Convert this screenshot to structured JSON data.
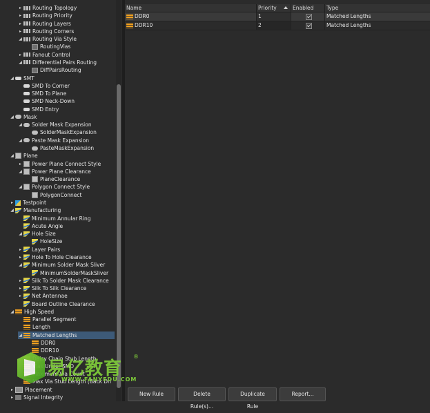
{
  "tree": [
    {
      "label": "Routing Topology",
      "indent": 1,
      "arrow": "▸",
      "icon": "route"
    },
    {
      "label": "Routing Priority",
      "indent": 1,
      "arrow": "▸",
      "icon": "route"
    },
    {
      "label": "Routing Layers",
      "indent": 1,
      "arrow": "▸",
      "icon": "route"
    },
    {
      "label": "Routing Corners",
      "indent": 1,
      "arrow": "▸",
      "icon": "route"
    },
    {
      "label": "Routing Via Style",
      "indent": 1,
      "arrow": "◢",
      "icon": "route"
    },
    {
      "label": "RoutingVias",
      "indent": 2,
      "arrow": "",
      "icon": "routesub"
    },
    {
      "label": "Fanout Control",
      "indent": 1,
      "arrow": "▸",
      "icon": "route"
    },
    {
      "label": "Differential Pairs Routing",
      "indent": 1,
      "arrow": "◢",
      "icon": "route"
    },
    {
      "label": "DiffPairsRouting",
      "indent": 2,
      "arrow": "",
      "icon": "routesub"
    },
    {
      "label": "SMT",
      "indent": 0,
      "arrow": "◢",
      "icon": "smd"
    },
    {
      "label": "SMD To Corner",
      "indent": 1,
      "arrow": "",
      "icon": "smd"
    },
    {
      "label": "SMD To Plane",
      "indent": 1,
      "arrow": "",
      "icon": "smd"
    },
    {
      "label": "SMD Neck-Down",
      "indent": 1,
      "arrow": "",
      "icon": "smd"
    },
    {
      "label": "SMD Entry",
      "indent": 1,
      "arrow": "",
      "icon": "smd"
    },
    {
      "label": "Mask",
      "indent": 0,
      "arrow": "◢",
      "icon": "mask"
    },
    {
      "label": "Solder Mask Expansion",
      "indent": 1,
      "arrow": "◢",
      "icon": "mask"
    },
    {
      "label": "SolderMaskExpansion",
      "indent": 2,
      "arrow": "",
      "icon": "mask"
    },
    {
      "label": "Paste Mask Expansion",
      "indent": 1,
      "arrow": "◢",
      "icon": "mask"
    },
    {
      "label": "PasteMaskExpansion",
      "indent": 2,
      "arrow": "",
      "icon": "mask"
    },
    {
      "label": "Plane",
      "indent": 0,
      "arrow": "◢",
      "icon": "plane"
    },
    {
      "label": "Power Plane Connect Style",
      "indent": 1,
      "arrow": "▸",
      "icon": "plane"
    },
    {
      "label": "Power Plane Clearance",
      "indent": 1,
      "arrow": "◢",
      "icon": "plane"
    },
    {
      "label": "PlaneClearance",
      "indent": 2,
      "arrow": "",
      "icon": "plane"
    },
    {
      "label": "Polygon Connect Style",
      "indent": 1,
      "arrow": "◢",
      "icon": "plane"
    },
    {
      "label": "PolygonConnect",
      "indent": 2,
      "arrow": "",
      "icon": "plane"
    },
    {
      "label": "Testpoint",
      "indent": 0,
      "arrow": "▸",
      "icon": "test"
    },
    {
      "label": "Manufacturing",
      "indent": 0,
      "arrow": "◢",
      "icon": "mfg"
    },
    {
      "label": "Minimum Annular Ring",
      "indent": 1,
      "arrow": "",
      "icon": "mfg"
    },
    {
      "label": "Acute Angle",
      "indent": 1,
      "arrow": "",
      "icon": "mfg"
    },
    {
      "label": "Hole Size",
      "indent": 1,
      "arrow": "◢",
      "icon": "mfg"
    },
    {
      "label": "HoleSize",
      "indent": 2,
      "arrow": "",
      "icon": "mfg"
    },
    {
      "label": "Layer Pairs",
      "indent": 1,
      "arrow": "▸",
      "icon": "mfg"
    },
    {
      "label": "Hole To Hole Clearance",
      "indent": 1,
      "arrow": "▸",
      "icon": "mfg"
    },
    {
      "label": "Minimum Solder Mask Sliver",
      "indent": 1,
      "arrow": "◢",
      "icon": "mfg"
    },
    {
      "label": "MinimumSolderMaskSliver",
      "indent": 2,
      "arrow": "",
      "icon": "mfg"
    },
    {
      "label": "Silk To Solder Mask Clearance",
      "indent": 1,
      "arrow": "▸",
      "icon": "mfg"
    },
    {
      "label": "Silk To Silk Clearance",
      "indent": 1,
      "arrow": "▸",
      "icon": "mfg"
    },
    {
      "label": "Net Antennae",
      "indent": 1,
      "arrow": "▸",
      "icon": "mfg"
    },
    {
      "label": "Board Outline Clearance",
      "indent": 1,
      "arrow": "",
      "icon": "mfg"
    },
    {
      "label": "High Speed",
      "indent": 0,
      "arrow": "◢",
      "icon": "hs"
    },
    {
      "label": "Parallel Segment",
      "indent": 1,
      "arrow": "",
      "icon": "hs"
    },
    {
      "label": "Length",
      "indent": 1,
      "arrow": "",
      "icon": "hs"
    },
    {
      "label": "Matched Lengths",
      "indent": 1,
      "arrow": "◢",
      "icon": "hs",
      "selected": true
    },
    {
      "label": "DDR0",
      "indent": 2,
      "arrow": "",
      "icon": "hs"
    },
    {
      "label": "DDR10",
      "indent": 2,
      "arrow": "",
      "icon": "hs"
    },
    {
      "label": "Daisy Chain Stub Length",
      "indent": 1,
      "arrow": "",
      "icon": "hs"
    },
    {
      "label": "Vias Under SMD",
      "indent": 1,
      "arrow": "",
      "icon": "hs"
    },
    {
      "label": "Maximum Via Count",
      "indent": 1,
      "arrow": "",
      "icon": "hs"
    },
    {
      "label": "Max Via Stub Length (Back Dri",
      "indent": 1,
      "arrow": "",
      "icon": "hs"
    },
    {
      "label": "Placement",
      "indent": 0,
      "arrow": "▸",
      "icon": "place"
    },
    {
      "label": "Signal Integrity",
      "indent": 0,
      "arrow": "▸",
      "icon": "signal"
    }
  ],
  "grid": {
    "columns": [
      "Name",
      "Priority",
      "Enabled",
      "Type"
    ],
    "rows": [
      {
        "name": "DDR0",
        "priority": "1",
        "type": "Matched Lengths"
      },
      {
        "name": "DDR10",
        "priority": "2",
        "type": "Matched Lengths"
      }
    ]
  },
  "buttons": {
    "new_rule": "New Rule",
    "delete_rule": "Delete Rule(s)...",
    "duplicate_rule": "Duplicate Rule",
    "report": "Report..."
  },
  "watermark": {
    "brand": "易亿教育",
    "registered": "®",
    "url": "WWW.FANYEDU.COM"
  }
}
